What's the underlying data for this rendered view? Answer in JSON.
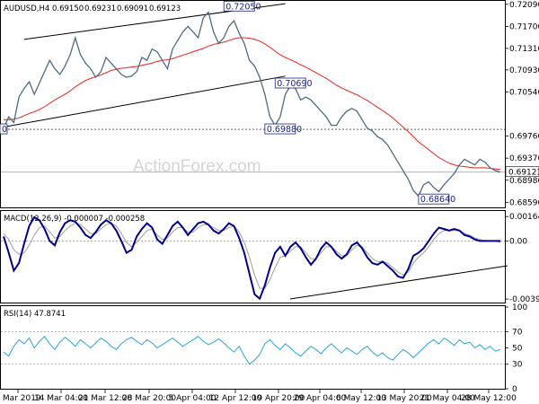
{
  "chart_data": [
    {
      "type": "line",
      "panel": "price",
      "header": {
        "symbol": "AUDUSD,H4",
        "open": "0.69150",
        "high": "0.69231",
        "low": "0.69091",
        "close": "0.69123"
      },
      "watermark": "ActionForex.com",
      "ylim": [
        0.685,
        0.7215
      ],
      "y_ticks": [
        "0.72090",
        "0.71700",
        "0.71310",
        "0.70930",
        "0.70540",
        "0.69760",
        "0.69370",
        "0.68980",
        "0.68590"
      ],
      "x_ticks": [
        "6 Mar 2019",
        "14 Mar 04:00",
        "21 Mar 12:00",
        "28 Mar 20:00",
        "5 Apr 04:00",
        "12 Apr 12:00",
        "19 Apr 20:00",
        "29 Apr 04:00",
        "6 May 12:00",
        "13 May 20:00",
        "21 May 04:00",
        "28 May 12:00"
      ],
      "close_series": [
        0.699,
        0.701,
        0.7,
        0.7045,
        0.706,
        0.7072,
        0.705,
        0.707,
        0.709,
        0.711,
        0.7095,
        0.7085,
        0.71,
        0.712,
        0.715,
        0.712,
        0.7105,
        0.7095,
        0.708,
        0.709,
        0.7115,
        0.7105,
        0.7095,
        0.7085,
        0.708,
        0.7082,
        0.709,
        0.7115,
        0.711,
        0.713,
        0.7125,
        0.711,
        0.7095,
        0.713,
        0.7145,
        0.716,
        0.717,
        0.716,
        0.715,
        0.7185,
        0.7195,
        0.716,
        0.714,
        0.715,
        0.717,
        0.718,
        0.7158,
        0.714,
        0.711,
        0.71,
        0.708,
        0.705,
        0.701,
        0.6995,
        0.701,
        0.705,
        0.7065,
        0.706,
        0.704,
        0.7045,
        0.704,
        0.703,
        0.702,
        0.701,
        0.6995,
        0.6995,
        0.701,
        0.702,
        0.7025,
        0.702,
        0.7005,
        0.699,
        0.6985,
        0.6975,
        0.697,
        0.696,
        0.6945,
        0.693,
        0.6915,
        0.69,
        0.688,
        0.687,
        0.689,
        0.6895,
        0.6885,
        0.6878,
        0.689,
        0.69,
        0.691,
        0.6925,
        0.6935,
        0.693,
        0.6925,
        0.6935,
        0.693,
        0.692,
        0.6915,
        0.6912
      ],
      "ma_series": [
        0.7005,
        0.7005,
        0.7006,
        0.7008,
        0.7012,
        0.7016,
        0.7019,
        0.7023,
        0.7028,
        0.7034,
        0.704,
        0.7045,
        0.705,
        0.7056,
        0.7063,
        0.7069,
        0.7074,
        0.7078,
        0.7081,
        0.7084,
        0.7088,
        0.7092,
        0.7094,
        0.7096,
        0.7097,
        0.7098,
        0.7099,
        0.7101,
        0.7103,
        0.7105,
        0.7108,
        0.711,
        0.7111,
        0.7113,
        0.7116,
        0.7119,
        0.7122,
        0.7125,
        0.7128,
        0.7131,
        0.7135,
        0.7138,
        0.714,
        0.7142,
        0.7145,
        0.7148,
        0.715,
        0.715,
        0.7149,
        0.7147,
        0.7144,
        0.7139,
        0.7133,
        0.7126,
        0.712,
        0.7115,
        0.7111,
        0.7107,
        0.7102,
        0.7098,
        0.7093,
        0.7088,
        0.7083,
        0.7078,
        0.7072,
        0.7066,
        0.7061,
        0.7057,
        0.7053,
        0.7049,
        0.7044,
        0.7039,
        0.7033,
        0.7027,
        0.7021,
        0.7015,
        0.7008,
        0.7,
        0.6992,
        0.6984,
        0.6975,
        0.6966,
        0.6959,
        0.6952,
        0.6945,
        0.6938,
        0.6933,
        0.6928,
        0.6925,
        0.6923,
        0.6922,
        0.6921,
        0.692,
        0.692,
        0.692,
        0.6919,
        0.6918,
        0.6917
      ],
      "hline": 0.6988,
      "current_price": "0.69123",
      "channel_upper": [
        [
          0.717,
          0.7209
        ]
      ],
      "annotations": [
        "0.72050",
        "0.70690",
        "0.69880",
        "0.68640",
        "0.69880"
      ],
      "colors": {
        "price": "#4e6b80",
        "ma": "#e8362c",
        "channel": "#000000",
        "label_box": "#1a237e"
      }
    },
    {
      "type": "line",
      "panel": "macd",
      "title": "MACD(12,26,9) -0.000007 -0.000258",
      "ylim": [
        -0.0041,
        0.0019
      ],
      "y_ticks": [
        "0.001646",
        "0.00",
        "-0.003922"
      ],
      "macd_series": [
        0.0003,
        -0.0008,
        -0.002,
        -0.0015,
        -0.0002,
        0.001,
        0.0016,
        0.0014,
        0.0008,
        0.0,
        -0.0003,
        0.0006,
        0.0012,
        0.0014,
        0.0013,
        0.0009,
        0.0004,
        0.0002,
        0.0006,
        0.0011,
        0.0014,
        0.0012,
        0.0007,
        0.0,
        -0.0008,
        -0.0006,
        0.0003,
        0.0008,
        0.0012,
        0.0009,
        0.0001,
        -0.0002,
        0.0004,
        0.001,
        0.0013,
        0.0009,
        0.0004,
        0.0008,
        0.0012,
        0.0013,
        0.0011,
        0.0007,
        0.0005,
        0.0008,
        0.0012,
        0.001,
        0.0002,
        -0.0008,
        -0.0022,
        -0.0036,
        -0.0039,
        -0.003,
        -0.0018,
        -0.0008,
        -0.0004,
        -0.001,
        -0.0004,
        -0.0001,
        -0.0005,
        -0.0011,
        -0.0016,
        -0.0012,
        -0.0005,
        -0.0001,
        -0.0004,
        -0.0009,
        -0.0012,
        -0.0009,
        -0.0003,
        -0.0001,
        -0.0005,
        -0.0011,
        -0.0015,
        -0.0016,
        -0.0014,
        -0.0017,
        -0.002,
        -0.0024,
        -0.0025,
        -0.0019,
        -0.001,
        -0.0008,
        -0.0005,
        0.0,
        0.0005,
        0.0009,
        0.0008,
        0.0007,
        0.0008,
        0.0007,
        0.0004,
        0.0003,
        0.0001,
        0.0,
        0.0,
        0.0,
        0.0,
        0.0
      ],
      "signal_series": [
        0.0005,
        0.0001,
        -0.0006,
        -0.0009,
        -0.0008,
        -0.0003,
        0.0004,
        0.0009,
        0.001,
        0.0006,
        0.0002,
        0.0003,
        0.0007,
        0.001,
        0.0012,
        0.0011,
        0.0008,
        0.0005,
        0.0005,
        0.0008,
        0.0011,
        0.0012,
        0.001,
        0.0005,
        -0.0001,
        -0.0004,
        -0.0001,
        0.0003,
        0.0007,
        0.0008,
        0.0004,
        0.0001,
        0.0002,
        0.0006,
        0.0009,
        0.0009,
        0.0006,
        0.0006,
        0.0009,
        0.0011,
        0.0011,
        0.0009,
        0.0007,
        0.0007,
        0.0009,
        0.001,
        0.0006,
        -0.0001,
        -0.0011,
        -0.0023,
        -0.0032,
        -0.0032,
        -0.0026,
        -0.0018,
        -0.0011,
        -0.001,
        -0.0007,
        -0.0004,
        -0.0004,
        -0.0008,
        -0.0012,
        -0.0012,
        -0.0008,
        -0.0004,
        -0.0004,
        -0.0007,
        -0.001,
        -0.001,
        -0.0006,
        -0.0003,
        -0.0004,
        -0.0008,
        -0.0012,
        -0.0014,
        -0.0014,
        -0.0015,
        -0.0018,
        -0.0021,
        -0.0023,
        -0.0021,
        -0.0015,
        -0.0011,
        -0.0008,
        -0.0004,
        0.0001,
        0.0005,
        0.0007,
        0.0007,
        0.0007,
        0.0007,
        0.0005,
        0.0004,
        0.0002,
        0.0001,
        0.0,
        0.0,
        0.0,
        -0.0001
      ],
      "colors": {
        "macd": "#00008b",
        "signal": "#9e9e9e",
        "trend": "#000000",
        "zero": "#888888"
      }
    },
    {
      "type": "line",
      "panel": "rsi",
      "title": "RSI(14) 47.8741",
      "ylim": [
        0,
        100
      ],
      "y_ticks": [
        "100",
        "70",
        "50",
        "30",
        "0"
      ],
      "rsi_series": [
        45,
        40,
        52,
        60,
        55,
        62,
        50,
        58,
        64,
        55,
        48,
        57,
        63,
        58,
        52,
        60,
        55,
        50,
        56,
        62,
        58,
        52,
        48,
        55,
        60,
        63,
        58,
        54,
        60,
        56,
        50,
        54,
        58,
        62,
        57,
        52,
        56,
        60,
        64,
        58,
        54,
        57,
        61,
        56,
        50,
        45,
        52,
        40,
        30,
        35,
        42,
        55,
        60,
        53,
        48,
        55,
        50,
        44,
        40,
        46,
        52,
        48,
        43,
        50,
        55,
        49,
        44,
        50,
        46,
        42,
        48,
        52,
        45,
        40,
        44,
        38,
        35,
        42,
        48,
        44,
        38,
        44,
        50,
        56,
        60,
        55,
        62,
        58,
        53,
        60,
        55,
        57,
        50,
        54,
        48,
        52,
        46,
        48
      ],
      "colors": {
        "rsi": "#29a3dc",
        "levels": "#888888"
      }
    }
  ]
}
